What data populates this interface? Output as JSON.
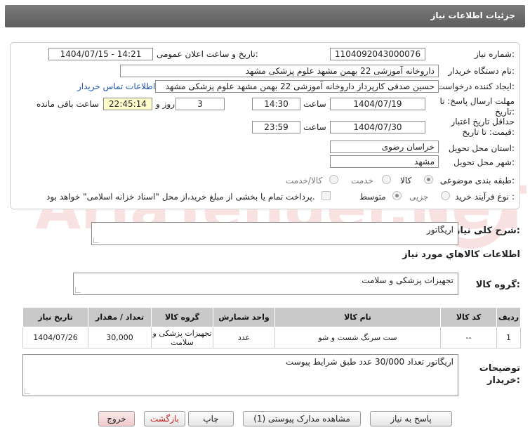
{
  "header": {
    "title": "جزئیات اطلاعات نیاز"
  },
  "form": {
    "need_number_label": "شماره نیاز:",
    "need_number": "1104092043000076",
    "announce_label": "تاریخ و ساعت اعلان عمومی:",
    "announce_value": "1404/07/15 - 14:21",
    "buyer_org_label": "نام دستگاه خریدار:",
    "buyer_org": "داروخانه آموزشی 22 بهمن مشهد   علوم پزشکی مشهد",
    "creator_label": "ایجاد کننده درخواست:",
    "creator": "حسین صدقی کارپرداز داروخانه آموزشی 22 بهمن مشهد   علوم پزشکی مشهد",
    "contact_link": "اطلاعات تماس خریدار",
    "reply_deadline_label": "مهلت ارسال پاسخ: تا تاریخ:",
    "reply_date": "1404/07/19",
    "time_label": "ساعت",
    "reply_time": "14:30",
    "days_value": "3",
    "days_label": "روز و",
    "remaining_time": "22:45:14",
    "remaining_label": "ساعت باقی مانده",
    "price_validity_label": "حداقل تاریخ اعتبار قیمت: تا تاریخ:",
    "price_date": "1404/07/30",
    "price_time": "23:59",
    "province_label": "استان محل تحویل:",
    "province": "خراسان رضوی",
    "city_label": "شهر محل تحویل:",
    "city": "مشهد",
    "category_label": "طبقه بندی موضوعی:",
    "category_options": [
      "کالا",
      "خدمت",
      "کالا/خدمت"
    ],
    "process_label": "نوع فرآیند خرید :",
    "process_options": [
      "جزیی",
      "متوسط"
    ],
    "payment_note": "پرداخت تمام یا بخشی از مبلغ خرید،از محل \"اسناد خزانه اسلامی\" خواهد بود."
  },
  "summary": {
    "label": "شرح کلی نیاز:",
    "value": "اریگاتور"
  },
  "goods": {
    "section_title": "اطلاعات کالاهاي مورد نياز",
    "group_label": "گروه کالا:",
    "group_value": "تجهیزات پزشکی و سلامت"
  },
  "table": {
    "headers": [
      "ردیف",
      "کد کالا",
      "نام کالا",
      "واحد شمارش",
      "گروه کالا",
      "تعداد / مقدار",
      "تاریخ نیاز"
    ],
    "rows": [
      [
        "1",
        "--",
        "ست سرنگ شست و شو",
        "عدد",
        "تجهیزات پزشکی و سلامت",
        "30,000",
        "1404/07/26"
      ]
    ]
  },
  "notes": {
    "label": "توضیحات خریدار:",
    "value": "اریگاتور تعداد 30/000 عدد طبق شرایط پیوست"
  },
  "buttons": {
    "reply": "پاسخ به نیاز",
    "attachments": "مشاهده مدارک پیوستی (1)",
    "print": "چاپ",
    "back": "بازگشت",
    "exit": "خروج"
  },
  "watermark": "AriaTender.neT",
  "colors": {
    "link": "#1e56b5",
    "highlight": "#fdfccb",
    "header": "#6b6b6b"
  }
}
